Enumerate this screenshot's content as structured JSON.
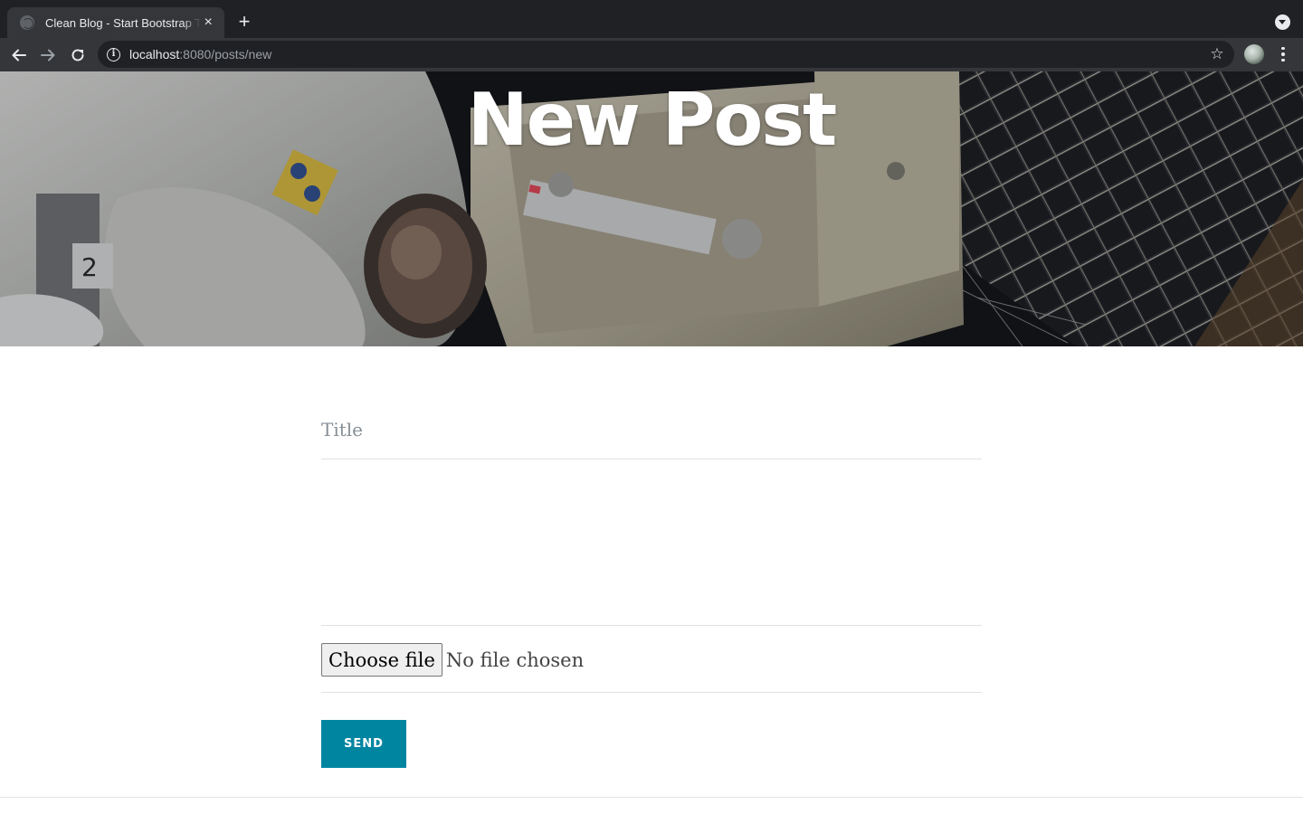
{
  "browser": {
    "tab_title": "Clean Blog - Start Bootstrap Theme",
    "tab_close_icon": "×",
    "new_tab_icon": "+",
    "url_host": "localhost",
    "url_rest": ":8080/posts/new",
    "star_icon": "☆"
  },
  "masthead": {
    "heading": "New Post"
  },
  "form": {
    "title_placeholder": "Title",
    "file_button_label": "Choose file",
    "file_status": "No file chosen",
    "send_label": "SEND"
  },
  "colors": {
    "accent": "#0085a1",
    "chrome_dark": "#202124",
    "chrome_toolbar": "#35363a"
  }
}
